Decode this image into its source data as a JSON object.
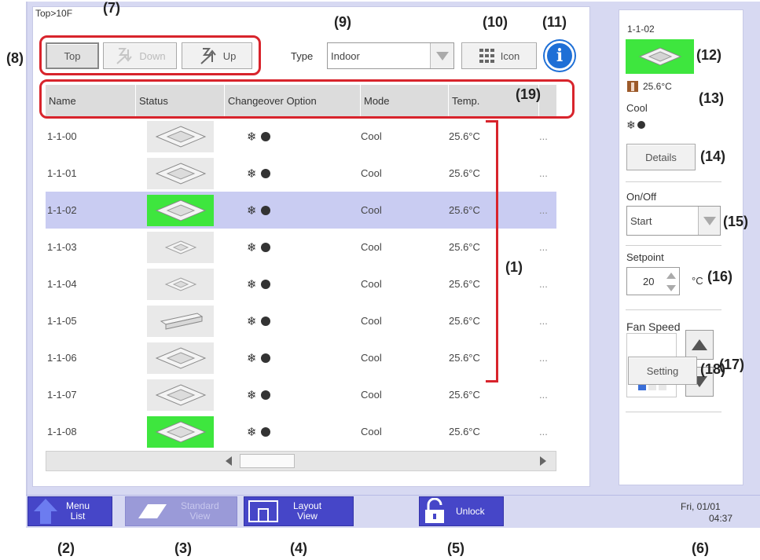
{
  "breadcrumb": "Top>10F",
  "toolbar": {
    "top_label": "Top",
    "down_label": "Down",
    "up_label": "Up",
    "type_label": "Type",
    "type_value": "Indoor",
    "icon_label": "Icon"
  },
  "table": {
    "headers": [
      "Name",
      "Status",
      "Changeover Option",
      "Mode",
      "Temp."
    ],
    "rows": [
      {
        "name": "1-1-00",
        "mode": "Cool",
        "temp": "25.6°C",
        "more": "...",
        "status_icon": "cassette-unit-icon",
        "status_color": "#e9e9e9"
      },
      {
        "name": "1-1-01",
        "mode": "Cool",
        "temp": "25.6°C",
        "more": "...",
        "status_icon": "cassette-unit-icon",
        "status_color": "#e9e9e9"
      },
      {
        "name": "1-1-02",
        "mode": "Cool",
        "temp": "25.6°C",
        "more": "...",
        "status_icon": "cassette-unit-icon",
        "status_color": "#3ee63e",
        "selected": true
      },
      {
        "name": "1-1-03",
        "mode": "Cool",
        "temp": "25.6°C",
        "more": "...",
        "status_icon": "small-cassette-unit-icon",
        "status_color": "#e9e9e9"
      },
      {
        "name": "1-1-04",
        "mode": "Cool",
        "temp": "25.6°C",
        "more": "...",
        "status_icon": "small-cassette-unit-icon",
        "status_color": "#e9e9e9"
      },
      {
        "name": "1-1-05",
        "mode": "Cool",
        "temp": "25.6°C",
        "more": "...",
        "status_icon": "ceiling-suspended-unit-icon",
        "status_color": "#e9e9e9"
      },
      {
        "name": "1-1-06",
        "mode": "Cool",
        "temp": "25.6°C",
        "more": "...",
        "status_icon": "cassette-unit-icon",
        "status_color": "#e9e9e9"
      },
      {
        "name": "1-1-07",
        "mode": "Cool",
        "temp": "25.6°C",
        "more": "...",
        "status_icon": "cassette-unit-icon",
        "status_color": "#e9e9e9"
      },
      {
        "name": "1-1-08",
        "mode": "Cool",
        "temp": "25.6°C",
        "more": "...",
        "status_icon": "cassette-unit-icon",
        "status_color": "#3ee63e"
      }
    ]
  },
  "side": {
    "unit_name": "1-1-02",
    "room_temp": "25.6°C",
    "mode": "Cool",
    "details_label": "Details",
    "onoff_label": "On/Off",
    "onoff_value": "Start",
    "setpoint_label": "Setpoint",
    "setpoint_value": "20",
    "setpoint_unit": "°C",
    "fan_speed_label": "Fan Speed",
    "fan_level": 1,
    "fan_levels_total": 3,
    "setting_label": "Setting"
  },
  "bottom": {
    "menu_list": "Menu\nList",
    "standard_view": "Standard\nView",
    "layout_view": "Layout\nView",
    "unlock": "Unlock",
    "date": "Fri, 01/01",
    "time": "04:37"
  },
  "callouts": {
    "c1": "(1)",
    "c2": "(2)",
    "c3": "(3)",
    "c4": "(4)",
    "c5": "(5)",
    "c6": "(6)",
    "c7": "(7)",
    "c8": "(8)",
    "c9": "(9)",
    "c10": "(10)",
    "c11": "(11)",
    "c12": "(12)",
    "c13": "(13)",
    "c14": "(14)",
    "c15": "(15)",
    "c16": "(16)",
    "c17": "(17)",
    "c18": "(18)",
    "c19": "(19)"
  },
  "colors": {
    "accent_blue": "#4646c8",
    "frame_lavender": "#d7d9f2",
    "status_on_green": "#3ee63e",
    "annotation_red": "#d8242c",
    "selected_row": "#c9ccf2"
  }
}
